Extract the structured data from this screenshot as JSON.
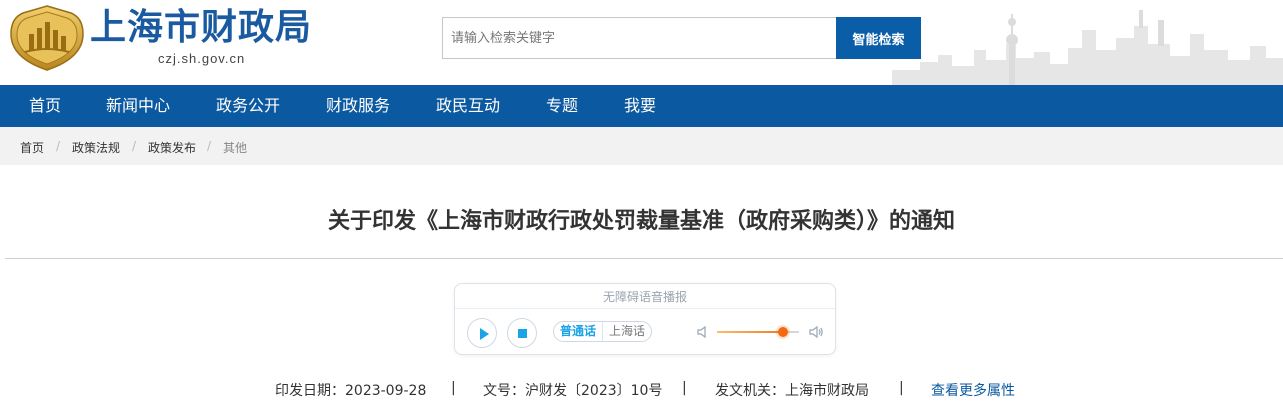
{
  "header": {
    "site_title": "上海市财政局",
    "site_domain": "czj.sh.gov.cn",
    "search_placeholder": "请输入检索关键字",
    "search_button": "智能检索"
  },
  "nav": {
    "items": [
      "首页",
      "新闻中心",
      "政务公开",
      "财政服务",
      "政民互动",
      "专题",
      "我要"
    ]
  },
  "breadcrumb": {
    "items": [
      "首页",
      "政策法规",
      "政策发布",
      "其他"
    ],
    "separator": "/"
  },
  "article": {
    "title": "关于印发《上海市财政行政处罚裁量基准（政府采购类）》的通知"
  },
  "player": {
    "label": "无障碍语音播报",
    "languages": [
      "普通话",
      "上海话"
    ],
    "selected_language": "普通话",
    "volume_fraction": 0.8
  },
  "meta": {
    "issue_date": "印发日期：2023-09-28",
    "doc_number": "文号：沪财发〔2023〕10号",
    "issuer": "发文机关：上海市财政局",
    "separator": "|",
    "more_link": "查看更多属性"
  },
  "colors": {
    "brand_blue": "#0b5aa1",
    "title_blue": "#1a5aa0",
    "emblem_gold": "#c99a2e",
    "accent_orange": "#f26a10",
    "player_active": "#1aa3e8"
  }
}
